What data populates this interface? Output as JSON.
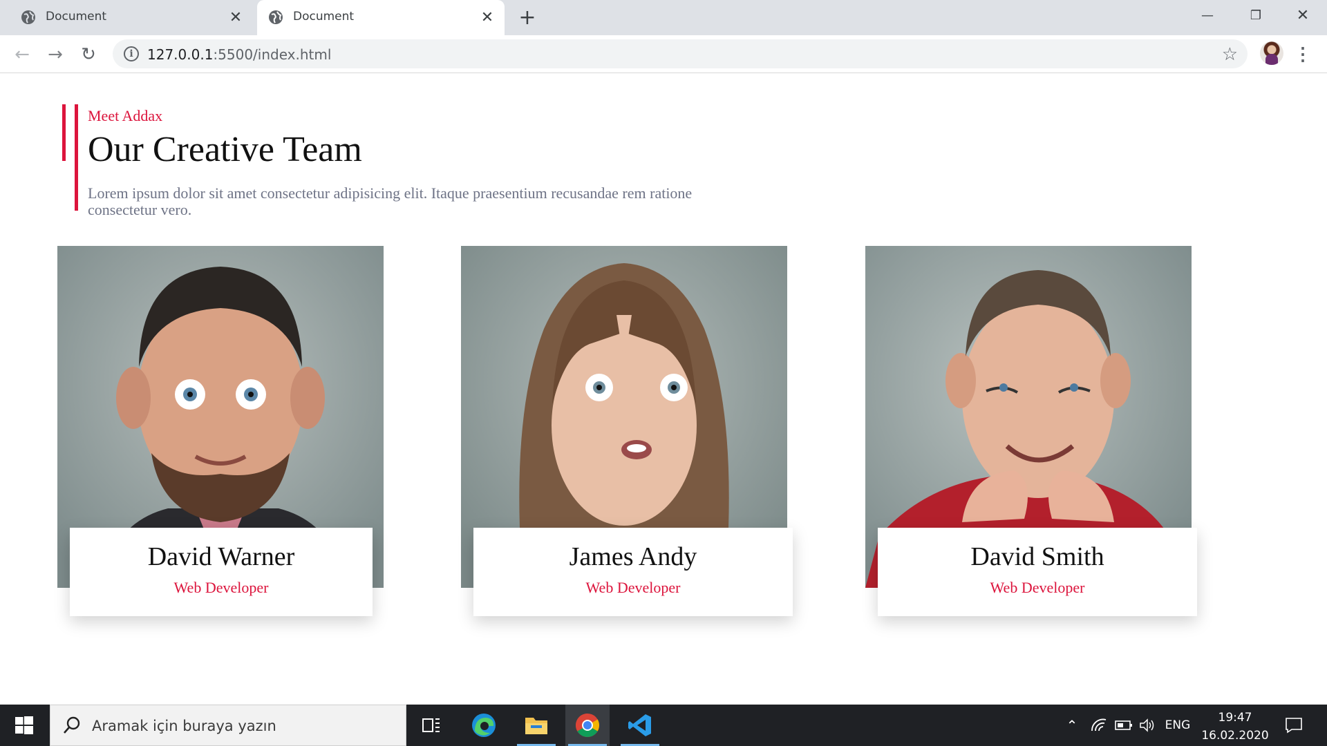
{
  "browser": {
    "tabs": [
      {
        "label": "Document",
        "active": false
      },
      {
        "label": "Document",
        "active": true
      }
    ],
    "new_tab_label": "+",
    "url_host": "127.0.0.1",
    "url_rest": ":5500/index.html"
  },
  "section": {
    "eyebrow": "Meet Addax",
    "heading": "Our Creative Team",
    "lede": "Lorem ipsum dolor sit amet consectetur adipisicing elit. Itaque praesentium recusandae rem ratione consectetur vero."
  },
  "team": [
    {
      "name": "David Warner",
      "role": "Web Developer"
    },
    {
      "name": "James Andy",
      "role": "Web Developer"
    },
    {
      "name": "David Smith",
      "role": "Web Developer"
    }
  ],
  "taskbar": {
    "search_placeholder": "Aramak için buraya yazın",
    "language": "ENG",
    "time": "19:47",
    "date": "16.02.2020"
  },
  "colors": {
    "accent": "#dc143c",
    "tabstrip": "#dee1e6",
    "taskbar": "#1f2125"
  },
  "icons": [
    "globe-icon",
    "close-icon",
    "plus-icon",
    "back-icon",
    "forward-icon",
    "reload-icon",
    "info-icon",
    "star-icon",
    "menu-icon",
    "windows-start-icon",
    "search-icon",
    "task-view-icon",
    "edge-icon",
    "file-explorer-icon",
    "chrome-icon",
    "vscode-icon",
    "chevron-up-icon",
    "network-icon",
    "battery-icon",
    "volume-icon",
    "notification-icon"
  ]
}
